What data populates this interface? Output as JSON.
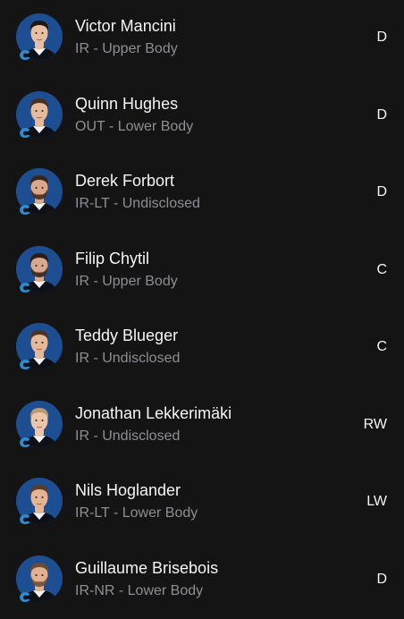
{
  "colors": {
    "background": "#141414",
    "avatar_bg": "#1e4e92",
    "team_logo": "#2e8bd0",
    "name": "#f5f5f5",
    "status": "#8e8e93"
  },
  "players": [
    {
      "name": "Victor Mancini",
      "status": "IR - Upper Body",
      "position": "D",
      "hair": "#1e1712",
      "skin": "#e8bfa3",
      "beard": false,
      "avatar_icon": "player-headshot-icon",
      "logo_icon": "canucks-logo-icon"
    },
    {
      "name": "Quinn Hughes",
      "status": "OUT - Lower Body",
      "position": "D",
      "hair": "#4a3020",
      "skin": "#e6bb9c",
      "beard": false,
      "avatar_icon": "player-headshot-icon",
      "logo_icon": "canucks-logo-icon"
    },
    {
      "name": "Derek Forbort",
      "status": "IR-LT - Undisclosed",
      "position": "D",
      "hair": "#3a2618",
      "skin": "#d9a88a",
      "beard": true,
      "avatar_icon": "player-headshot-icon",
      "logo_icon": "canucks-logo-icon"
    },
    {
      "name": "Filip Chytil",
      "status": "IR - Upper Body",
      "position": "C",
      "hair": "#2a1d14",
      "skin": "#d8a98c",
      "beard": true,
      "avatar_icon": "player-headshot-icon",
      "logo_icon": "canucks-logo-icon"
    },
    {
      "name": "Teddy Blueger",
      "status": "IR - Undisclosed",
      "position": "C",
      "hair": "#4b3322",
      "skin": "#e4b898",
      "beard": false,
      "avatar_icon": "player-headshot-icon",
      "logo_icon": "canucks-logo-icon"
    },
    {
      "name": "Jonathan Lekkerimäki",
      "status": "IR - Undisclosed",
      "position": "RW",
      "hair": "#b99a74",
      "skin": "#ecc6aa",
      "beard": false,
      "avatar_icon": "player-headshot-icon",
      "logo_icon": "canucks-logo-icon"
    },
    {
      "name": "Nils Hoglander",
      "status": "IR-LT - Lower Body",
      "position": "LW",
      "hair": "#5a3d27",
      "skin": "#e3b594",
      "beard": false,
      "avatar_icon": "player-headshot-icon",
      "logo_icon": "canucks-logo-icon"
    },
    {
      "name": "Guillaume Brisebois",
      "status": "IR-NR - Lower Body",
      "position": "D",
      "hair": "#6a4a30",
      "skin": "#e2b191",
      "beard": true,
      "avatar_icon": "player-headshot-icon",
      "logo_icon": "canucks-logo-icon"
    }
  ]
}
